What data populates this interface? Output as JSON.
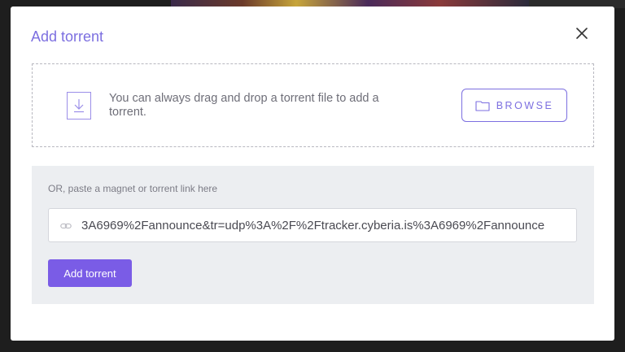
{
  "modal": {
    "title": "Add torrent",
    "close_icon": "close-icon"
  },
  "dropzone": {
    "icon": "download-file-icon",
    "text": "You can always drag and drop a torrent file to add a torrent.",
    "browse_label": "BROWSE",
    "browse_icon": "folder-icon"
  },
  "magnet": {
    "label": "OR, paste a magnet or torrent link here",
    "icon": "link-icon",
    "value": "3A6969%2Fannounce&tr=udp%3A%2F%2Ftracker.cyberia.is%3A6969%2Fannounce",
    "submit_label": "Add torrent"
  },
  "colors": {
    "accent": "#7c6fe0",
    "button": "#7a5ce6",
    "panel": "#eceef1"
  }
}
